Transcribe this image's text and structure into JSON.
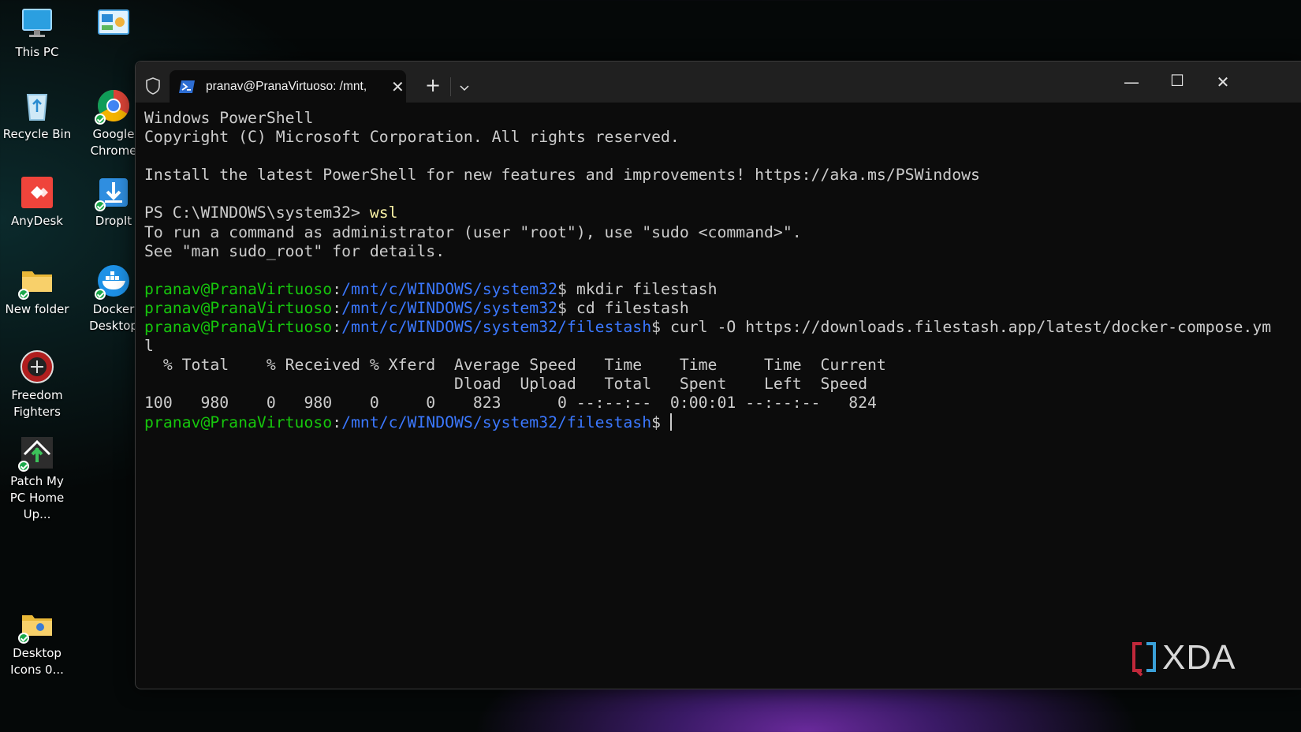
{
  "desktop": {
    "icons": [
      {
        "label": "This PC"
      },
      {
        "label": ""
      },
      {
        "label": "Recycle Bin"
      },
      {
        "label": "Google Chrome"
      },
      {
        "label": "AnyDesk"
      },
      {
        "label": "DropIt"
      },
      {
        "label": "New folder"
      },
      {
        "label": "Docker Desktop"
      },
      {
        "label": "Freedom Fighters"
      },
      {
        "label": "Patch My PC Home Up..."
      },
      {
        "label": "Desktop Icons 0..."
      }
    ]
  },
  "terminal": {
    "tab_title": "pranav@PranaVirtuoso: /mnt,",
    "lines": {
      "l1": "Windows PowerShell",
      "l2": "Copyright (C) Microsoft Corporation. All rights reserved.",
      "l3": "Install the latest PowerShell for new features and improvements! https://aka.ms/PSWindows",
      "ps_prompt": "PS C:\\WINDOWS\\system32> ",
      "ps_cmd": "wsl",
      "l5": "To run a command as administrator (user \"root\"), use \"sudo <command>\".",
      "l6": "See \"man sudo_root\" for details.",
      "user": "pranav@PranaVirtuoso",
      "path1": "/mnt/c/WINDOWS/system32",
      "cmd1": "$ mkdir filestash",
      "cmd2": "$ cd filestash",
      "path2": "/mnt/c/WINDOWS/system32/filestash",
      "cmd3": "$ curl -O https://downloads.filestash.app/latest/docker-compose.ym",
      "cmd3_wrap": "l",
      "curl_h1": "  % Total    % Received % Xferd  Average Speed   Time    Time     Time  Current",
      "curl_h2": "                                 Dload  Upload   Total   Spent    Left  Speed",
      "curl_row": "100   980    0   980    0     0    823      0 --:--:--  0:00:01 --:--:--   824",
      "prompt_end": "$ "
    }
  },
  "watermark": "XDA",
  "colors": {
    "green": "#16c60c",
    "blue": "#3b78ff",
    "yellow": "#f9f1a5",
    "text": "#cccccc",
    "bg": "#0c0c0c"
  }
}
